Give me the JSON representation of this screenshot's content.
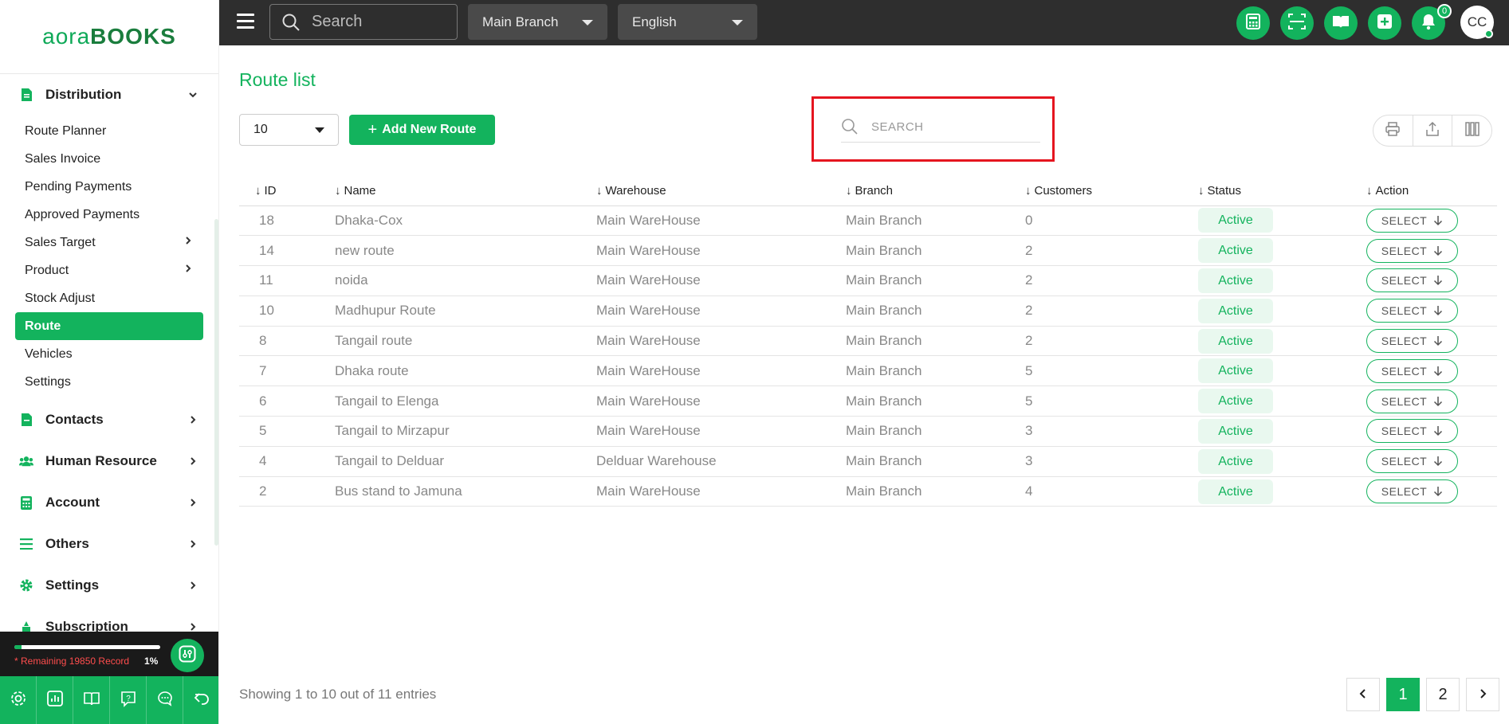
{
  "brand": {
    "logo_part1": "aora",
    "logo_part2": "BOOKS"
  },
  "sidebar": {
    "distribution": {
      "label": "Distribution",
      "items": [
        {
          "label": "Route Planner"
        },
        {
          "label": "Sales Invoice"
        },
        {
          "label": "Pending Payments"
        },
        {
          "label": "Approved Payments"
        },
        {
          "label": "Sales Target"
        },
        {
          "label": "Product"
        },
        {
          "label": "Stock Adjust"
        },
        {
          "label": "Route"
        },
        {
          "label": "Vehicles"
        },
        {
          "label": "Settings"
        }
      ]
    },
    "groups": [
      {
        "label": "Contacts",
        "icon": "contacts-icon"
      },
      {
        "label": "Human Resource",
        "icon": "users-icon"
      },
      {
        "label": "Account",
        "icon": "calculator-icon"
      },
      {
        "label": "Others",
        "icon": "list-icon"
      },
      {
        "label": "Settings",
        "icon": "gear-icon"
      },
      {
        "label": "Subscription",
        "icon": "subscription-icon"
      }
    ],
    "quota": {
      "text": "* Remaining 19850 Record",
      "percent": "1%",
      "fill_fraction": 0.05
    }
  },
  "topbar": {
    "search_placeholder": "Search",
    "branch": "Main Branch",
    "language": "English",
    "notification_count": "0",
    "user_initials": "CC"
  },
  "page": {
    "title": "Route list",
    "per_page": "10",
    "add_button": "Add New Route",
    "search_placeholder": "SEARCH",
    "columns": [
      "ID",
      "Name",
      "Warehouse",
      "Branch",
      "Customers",
      "Status",
      "Action"
    ],
    "rows": [
      {
        "id": "18",
        "name": "Dhaka-Cox",
        "warehouse": "Main WareHouse",
        "branch": "Main Branch",
        "customers": "0",
        "status": "Active",
        "action": "SELECT"
      },
      {
        "id": "14",
        "name": "new route",
        "warehouse": "Main WareHouse",
        "branch": "Main Branch",
        "customers": "2",
        "status": "Active",
        "action": "SELECT"
      },
      {
        "id": "11",
        "name": "noida",
        "warehouse": "Main WareHouse",
        "branch": "Main Branch",
        "customers": "2",
        "status": "Active",
        "action": "SELECT"
      },
      {
        "id": "10",
        "name": "Madhupur Route",
        "warehouse": "Main WareHouse",
        "branch": "Main Branch",
        "customers": "2",
        "status": "Active",
        "action": "SELECT"
      },
      {
        "id": "8",
        "name": "Tangail route",
        "warehouse": "Main WareHouse",
        "branch": "Main Branch",
        "customers": "2",
        "status": "Active",
        "action": "SELECT"
      },
      {
        "id": "7",
        "name": "Dhaka route",
        "warehouse": "Main WareHouse",
        "branch": "Main Branch",
        "customers": "5",
        "status": "Active",
        "action": "SELECT"
      },
      {
        "id": "6",
        "name": "Tangail to Elenga",
        "warehouse": "Main WareHouse",
        "branch": "Main Branch",
        "customers": "5",
        "status": "Active",
        "action": "SELECT"
      },
      {
        "id": "5",
        "name": "Tangail to Mirzapur",
        "warehouse": "Main WareHouse",
        "branch": "Main Branch",
        "customers": "3",
        "status": "Active",
        "action": "SELECT"
      },
      {
        "id": "4",
        "name": "Tangail to Delduar",
        "warehouse": "Delduar Warehouse",
        "branch": "Main Branch",
        "customers": "3",
        "status": "Active",
        "action": "SELECT"
      },
      {
        "id": "2",
        "name": "Bus stand to Jamuna",
        "warehouse": "Main WareHouse",
        "branch": "Main Branch",
        "customers": "4",
        "status": "Active",
        "action": "SELECT"
      }
    ],
    "showing_text": "Showing 1 to 10 out of 11 entries",
    "pages": [
      "1",
      "2"
    ],
    "current_page": "1"
  },
  "colors": {
    "accent": "#13b35d",
    "topbar": "#2e2e2e",
    "highlight": "#e5151f"
  }
}
